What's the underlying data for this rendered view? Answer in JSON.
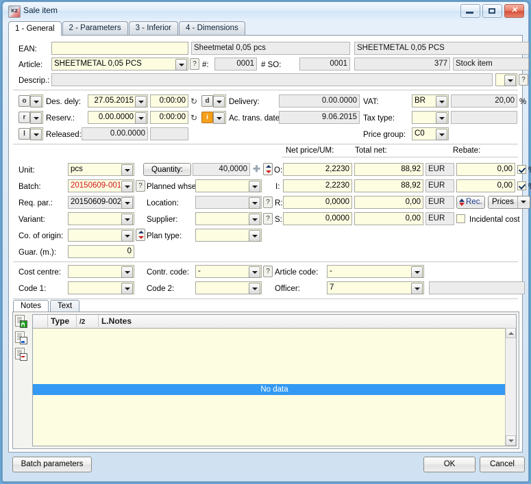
{
  "window": {
    "title": "Sale item",
    "icon": "k2-app-icon",
    "controls": {
      "minimize": "minimize",
      "maximize": "maximize",
      "close": "close"
    }
  },
  "tabs": [
    {
      "label": "1 - General",
      "active": true
    },
    {
      "label": "2 - Parameters",
      "active": false
    },
    {
      "label": "3 - Inferior",
      "active": false
    },
    {
      "label": "4 - Dimensions",
      "active": false
    }
  ],
  "header": {
    "ean_label": "EAN:",
    "ean_value": "",
    "ean_desc": "Sheetmetal 0,05 pcs",
    "ean_desc2": "SHEETMETAL 0,05 PCS",
    "article_label": "Article:",
    "article_value": "SHEETMETAL 0,05 PCS",
    "hash_label": "#:",
    "hash_value": "0001",
    "so_label": "# SO:",
    "so_value": "0001",
    "so_num": "377",
    "stock_item": "Stock item",
    "descrip_label": "Descrip.:",
    "descrip_value": "",
    "descrip_combo": ""
  },
  "dates": {
    "flag_o": "o",
    "des_dely_label": "Des. dely:",
    "des_dely_date": "27.05.2015",
    "des_dely_time": "0:00:00",
    "flag_d": "d",
    "delivery_label": "Delivery:",
    "delivery_value": "0.00.0000",
    "flag_r": "r",
    "reserv_label": "Reserv.:",
    "reserv_date": "0.00.0000",
    "reserv_time": "0:00:00",
    "flag_i": "i",
    "ac_trans_label": "Ac. trans. date:",
    "ac_trans_value": "9.06.2015",
    "flag_l": "l",
    "released_label": "Released:",
    "released_value": "0.00.0000",
    "released_time": "",
    "vat_label": "VAT:",
    "vat_value": "BR",
    "vat_pct": "20,00",
    "pct_sign": "%",
    "tax_type_label": "Tax type:",
    "tax_type_value": "",
    "tax_type_extra": "",
    "price_group_label": "Price group:",
    "price_group_value": "C0"
  },
  "main": {
    "unit_label": "Unit:",
    "unit_value": "pcs",
    "quantity_button": "Quantity:",
    "quantity_value": "40,0000",
    "batch_label": "Batch:",
    "batch_value": "20150609-001",
    "planned_whse_label": "Planned whse:",
    "planned_whse_value": "",
    "req_par_label": "Req. par.:",
    "req_par_value": "20150609-002",
    "location_label": "Location:",
    "location_value": "",
    "variant_label": "Variant:",
    "variant_value": "",
    "supplier_label": "Supplier:",
    "supplier_value": "",
    "co_origin_label": "Co. of origin:",
    "co_origin_value": "",
    "plan_type_label": "Plan type:",
    "plan_type_value": "",
    "guar_label": "Guar. (m.):",
    "guar_value": "0",
    "col_net_price": "Net price/UM:",
    "col_total_net": "Total net:",
    "col_rebate": "Rebate:",
    "rows": [
      {
        "code": "O:",
        "net_price": "2,2230",
        "total_net": "88,92",
        "currency": "EUR",
        "rebate": "0,00",
        "checked": true,
        "pct": "%"
      },
      {
        "code": "I:",
        "net_price": "2,2230",
        "total_net": "88,92",
        "currency": "EUR",
        "rebate": "0,00",
        "checked": true,
        "pct": "%"
      },
      {
        "code": "R:",
        "net_price": "0,0000",
        "total_net": "0,00",
        "currency": "EUR",
        "rebate": "",
        "checked": false,
        "pct": ""
      },
      {
        "code": "S:",
        "net_price": "0,0000",
        "total_net": "0,00",
        "currency": "EUR",
        "rebate": "",
        "checked": false,
        "pct": ""
      }
    ],
    "rec_button": "Rec.",
    "prices_button": "Prices",
    "incidental_cost_label": "Incidental cost",
    "incidental_cost_checked": false
  },
  "codes": {
    "cost_centre_label": "Cost centre:",
    "cost_centre_value": "",
    "contr_code_label": "Contr. code:",
    "contr_code_value": "-",
    "article_code_label": "Article code:",
    "article_code_value": "-",
    "code1_label": "Code 1:",
    "code1_value": "",
    "code2_label": "Code 2:",
    "code2_value": "",
    "officer_label": "Officer:",
    "officer_value": "7",
    "officer_extra": ""
  },
  "notes": {
    "tabs": [
      {
        "label": "Notes",
        "active": true
      },
      {
        "label": "Text",
        "active": false
      }
    ],
    "toolbar": [
      {
        "name": "add-note-icon",
        "label": "Add note"
      },
      {
        "name": "edit-note-icon",
        "label": "Edit note"
      },
      {
        "name": "delete-note-icon",
        "label": "Delete note"
      }
    ],
    "columns": [
      "",
      "Type",
      "/2",
      "L.Notes"
    ],
    "empty_text": "No data",
    "rows": []
  },
  "footer": {
    "batch_parameters": "Batch parameters",
    "ok": "OK",
    "cancel": "Cancel"
  },
  "colors": {
    "field_bg": "#fdfde2",
    "readonly_bg": "#ececec",
    "selection": "#3399f3",
    "batch_text": "#d01616",
    "accent": "#f5a01b"
  }
}
